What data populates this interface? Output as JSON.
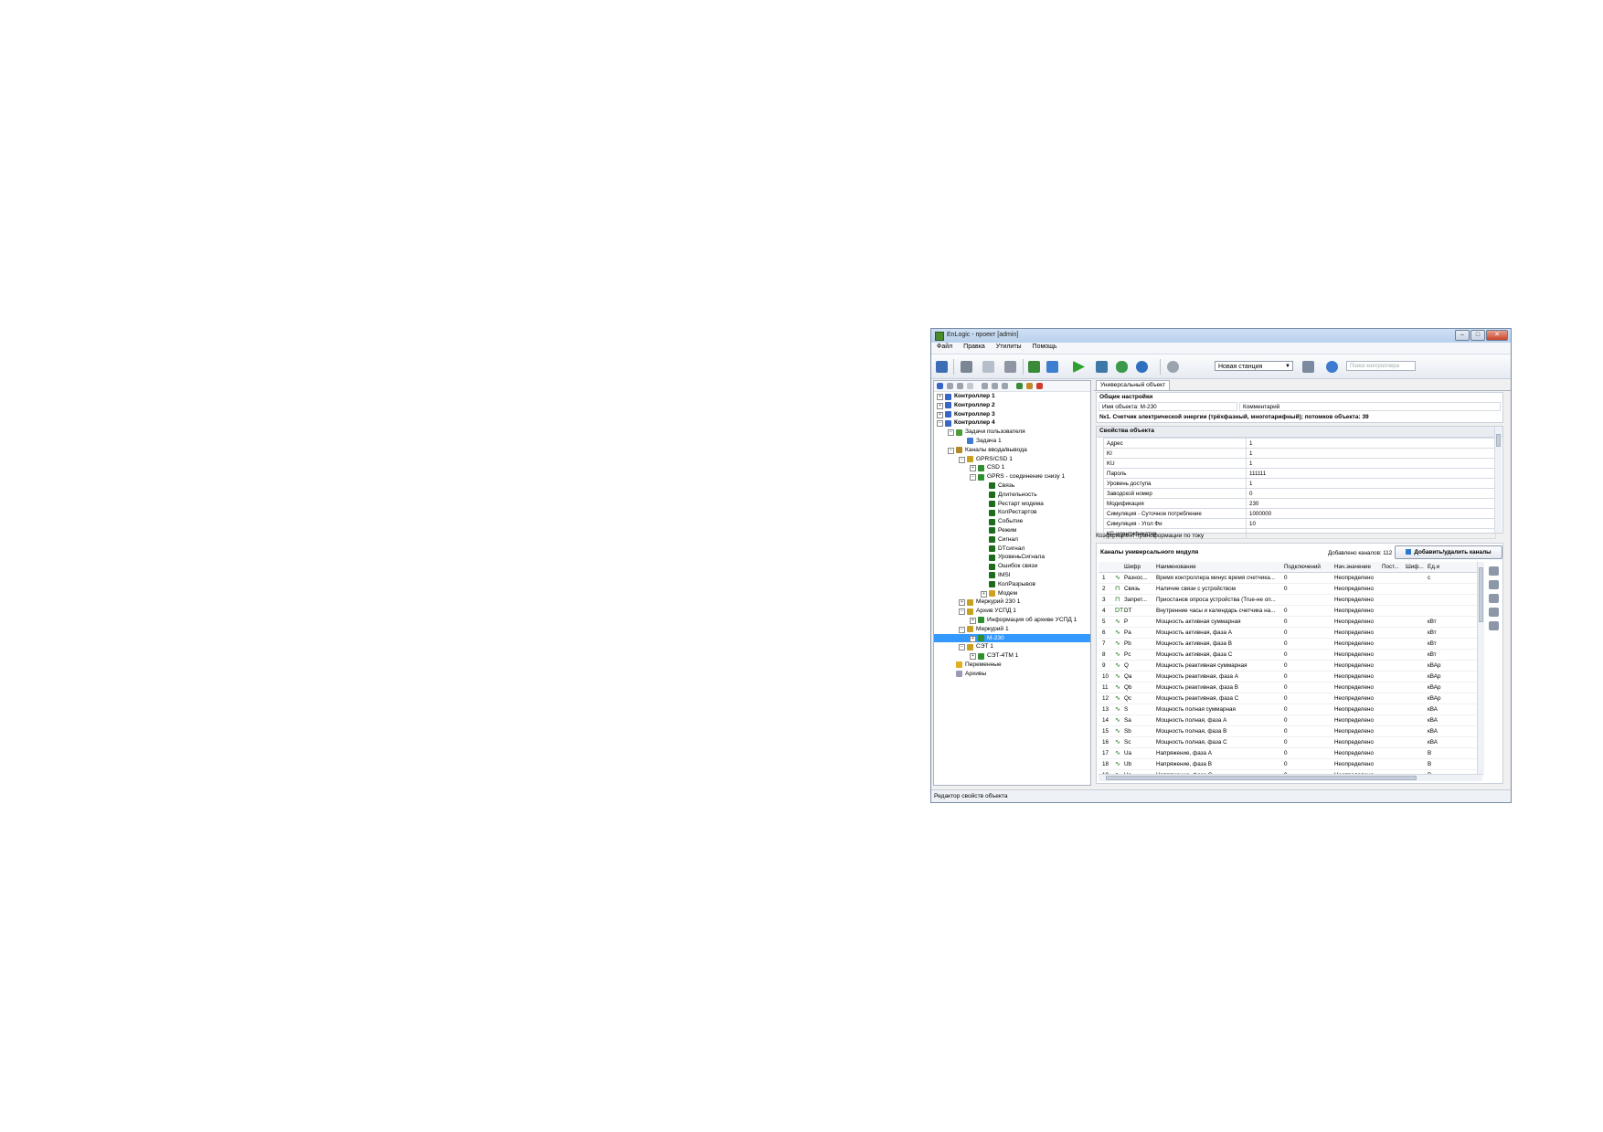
{
  "window": {
    "title": "EnLogic - проект [admin]"
  },
  "menu": [
    "Файл",
    "Правка",
    "Утилиты",
    "Помощь"
  ],
  "toolbar": {
    "station_value": "Новая станция",
    "search_placeholder": "Поиск контроллера"
  },
  "tree": [
    {
      "label": "Контроллер 1",
      "depth": 0,
      "exp": "+",
      "bold": true,
      "icon": "#3566c8"
    },
    {
      "label": "Контроллер 2",
      "depth": 0,
      "exp": "+",
      "bold": true,
      "icon": "#3566c8"
    },
    {
      "label": "Контроллер 3",
      "depth": 0,
      "exp": "+",
      "bold": true,
      "icon": "#3566c8"
    },
    {
      "label": "Контроллер 4",
      "depth": 0,
      "exp": "−",
      "bold": true,
      "icon": "#3566c8"
    },
    {
      "label": "Задачи пользователя",
      "depth": 1,
      "exp": "−",
      "icon": "#4a9a3a"
    },
    {
      "label": "Задача 1",
      "depth": 2,
      "exp": "",
      "icon": "#3d7ad0"
    },
    {
      "label": "Каналы ввода/вывода",
      "depth": 1,
      "exp": "−",
      "icon": "#b08a2a"
    },
    {
      "label": "GPRS/CSD 1",
      "depth": 2,
      "exp": "−",
      "icon": "#c8a020"
    },
    {
      "label": "CSD 1",
      "depth": 3,
      "exp": "+",
      "icon": "#2f8f2f"
    },
    {
      "label": "GPRS - соединение снизу 1",
      "depth": 3,
      "exp": "−",
      "icon": "#2f8f2f"
    },
    {
      "label": "Связь",
      "depth": 4,
      "exp": "",
      "icon": "#1d6b1d"
    },
    {
      "label": "Длительность",
      "depth": 4,
      "exp": "",
      "icon": "#1d6b1d"
    },
    {
      "label": "Рестарт модема",
      "depth": 4,
      "exp": "",
      "icon": "#1d6b1d"
    },
    {
      "label": "КолРестартов",
      "depth": 4,
      "exp": "",
      "icon": "#1d6b1d"
    },
    {
      "label": "Событие",
      "depth": 4,
      "exp": "",
      "icon": "#1d6b1d"
    },
    {
      "label": "Режим",
      "depth": 4,
      "exp": "",
      "icon": "#1d6b1d"
    },
    {
      "label": "Сигнал",
      "depth": 4,
      "exp": "",
      "icon": "#1d6b1d"
    },
    {
      "label": "DTсигнал",
      "depth": 4,
      "exp": "",
      "icon": "#1d6b1d"
    },
    {
      "label": "УровеньСигнала",
      "depth": 4,
      "exp": "",
      "icon": "#1d6b1d"
    },
    {
      "label": "Ошибок связи",
      "depth": 4,
      "exp": "",
      "icon": "#1d6b1d"
    },
    {
      "label": "IMSI",
      "depth": 4,
      "exp": "",
      "icon": "#1d6b1d"
    },
    {
      "label": "КолРазрывов",
      "depth": 4,
      "exp": "",
      "icon": "#1d6b1d"
    },
    {
      "label": "Модем",
      "depth": 4,
      "exp": "+",
      "icon": "#d0a020"
    },
    {
      "label": "Меркурий 230 1",
      "depth": 2,
      "exp": "+",
      "icon": "#c8a020"
    },
    {
      "label": "Архив УСПД 1",
      "depth": 2,
      "exp": "−",
      "icon": "#c8a020"
    },
    {
      "label": "Информация об архиве УСПД 1",
      "depth": 3,
      "exp": "+",
      "icon": "#2f8f2f"
    },
    {
      "label": "Меркурий 1",
      "depth": 2,
      "exp": "−",
      "icon": "#c8a020"
    },
    {
      "label": "М-230",
      "depth": 3,
      "exp": "+",
      "icon": "#2f8f2f",
      "selected": true
    },
    {
      "label": "СЭТ 1",
      "depth": 2,
      "exp": "−",
      "icon": "#c8a020"
    },
    {
      "label": "СЭТ-4ТМ 1",
      "depth": 3,
      "exp": "+",
      "icon": "#2f8f2f"
    },
    {
      "label": "Переменные",
      "depth": 1,
      "exp": "",
      "icon": "#e0b020"
    },
    {
      "label": "Архивы",
      "depth": 1,
      "exp": "",
      "icon": "#9a9ab8"
    }
  ],
  "tab": {
    "label": "Универсальный объект"
  },
  "general": {
    "title": "Общие настройки",
    "name_field": "Имя объекта: М-230",
    "comment_field": "Комментарий",
    "description": "№1. Счетчик электрической энергии (трёхфазный, многотарифный); потомков объекта: 39"
  },
  "props": {
    "title": "Свойства объекта",
    "rows": [
      {
        "k": "Адрес",
        "v": "1"
      },
      {
        "k": "KI",
        "v": "1"
      },
      {
        "k": "KU",
        "v": "1"
      },
      {
        "k": "Пароль",
        "v": "111111"
      },
      {
        "k": "Уровень доступа",
        "v": "1"
      },
      {
        "k": "Заводской номер",
        "v": "0"
      },
      {
        "k": "Модификация",
        "v": "230"
      },
      {
        "k": "Симуляция - Суточное потребление",
        "v": "1000000"
      },
      {
        "k": "Симуляция - Угол Фи",
        "v": "10"
      },
      {
        "k": "КС-идентификатор",
        "v": ""
      }
    ],
    "hint": "Коэффициент трансформации по току"
  },
  "channels": {
    "title": "Каналы универсального модуля",
    "count_text": "Добавлено каналов: 112",
    "add_button": "Добавить/удалить каналы",
    "headers": [
      "Шифр",
      "Наименование",
      "Подключений",
      "Нач.значение",
      "Пост...",
      "Шиф...",
      "Ед.и"
    ],
    "rows": [
      {
        "n": "1",
        "s": "Разнос...",
        "name": "Время контроллера минус время счетчика...",
        "con": "0",
        "init": "Неопределено",
        "unit": "с",
        "kind": "~"
      },
      {
        "n": "2",
        "s": "Связь",
        "name": "Наличие связи с устройством",
        "con": "0",
        "init": "Неопределено",
        "unit": "",
        "kind": "b"
      },
      {
        "n": "3",
        "s": "Запрет...",
        "name": "Приостанов опроса устройства (True-не оп...",
        "con": "",
        "init": "Неопределено",
        "unit": "",
        "kind": "b"
      },
      {
        "n": "4",
        "s": "DT",
        "name": "Внутренние часы и календарь счетчика на...",
        "con": "0",
        "init": "Неопределено",
        "unit": "",
        "kind": "d"
      },
      {
        "n": "5",
        "s": "P",
        "name": "Мощность активная суммарная",
        "con": "0",
        "init": "Неопределено",
        "unit": "кВт",
        "kind": "~"
      },
      {
        "n": "6",
        "s": "Pa",
        "name": "Мощность активная, фаза А",
        "con": "0",
        "init": "Неопределено",
        "unit": "кВт",
        "kind": "~"
      },
      {
        "n": "7",
        "s": "Pb",
        "name": "Мощность активная, фаза В",
        "con": "0",
        "init": "Неопределено",
        "unit": "кВт",
        "kind": "~"
      },
      {
        "n": "8",
        "s": "Pc",
        "name": "Мощность активная, фаза С",
        "con": "0",
        "init": "Неопределено",
        "unit": "кВт",
        "kind": "~"
      },
      {
        "n": "9",
        "s": "Q",
        "name": "Мощность реактивная суммарная",
        "con": "0",
        "init": "Неопределено",
        "unit": "кВАр",
        "kind": "~"
      },
      {
        "n": "10",
        "s": "Qa",
        "name": "Мощность реактивная, фаза А",
        "con": "0",
        "init": "Неопределено",
        "unit": "кВАр",
        "kind": "~"
      },
      {
        "n": "11",
        "s": "Qb",
        "name": "Мощность реактивная, фаза В",
        "con": "0",
        "init": "Неопределено",
        "unit": "кВАр",
        "kind": "~"
      },
      {
        "n": "12",
        "s": "Qc",
        "name": "Мощность реактивная, фаза С",
        "con": "0",
        "init": "Неопределено",
        "unit": "кВАр",
        "kind": "~"
      },
      {
        "n": "13",
        "s": "S",
        "name": "Мощность полная суммарная",
        "con": "0",
        "init": "Неопределено",
        "unit": "кВА",
        "kind": "~"
      },
      {
        "n": "14",
        "s": "Sa",
        "name": "Мощность полная, фаза А",
        "con": "0",
        "init": "Неопределено",
        "unit": "кВА",
        "kind": "~"
      },
      {
        "n": "15",
        "s": "Sb",
        "name": "Мощность полная, фаза В",
        "con": "0",
        "init": "Неопределено",
        "unit": "кВА",
        "kind": "~"
      },
      {
        "n": "16",
        "s": "Sc",
        "name": "Мощность полная, фаза С",
        "con": "0",
        "init": "Неопределено",
        "unit": "кВА",
        "kind": "~"
      },
      {
        "n": "17",
        "s": "Ua",
        "name": "Напряжение, фаза А",
        "con": "0",
        "init": "Неопределено",
        "unit": "В",
        "kind": "~"
      },
      {
        "n": "18",
        "s": "Ub",
        "name": "Напряжение, фаза В",
        "con": "0",
        "init": "Неопределено",
        "unit": "В",
        "kind": "~"
      },
      {
        "n": "19",
        "s": "Uc",
        "name": "Напряжение, фаза С",
        "con": "0",
        "init": "Неопределено",
        "unit": "В",
        "kind": "~"
      }
    ]
  },
  "status": {
    "text": "Редактор свойств объекта"
  }
}
